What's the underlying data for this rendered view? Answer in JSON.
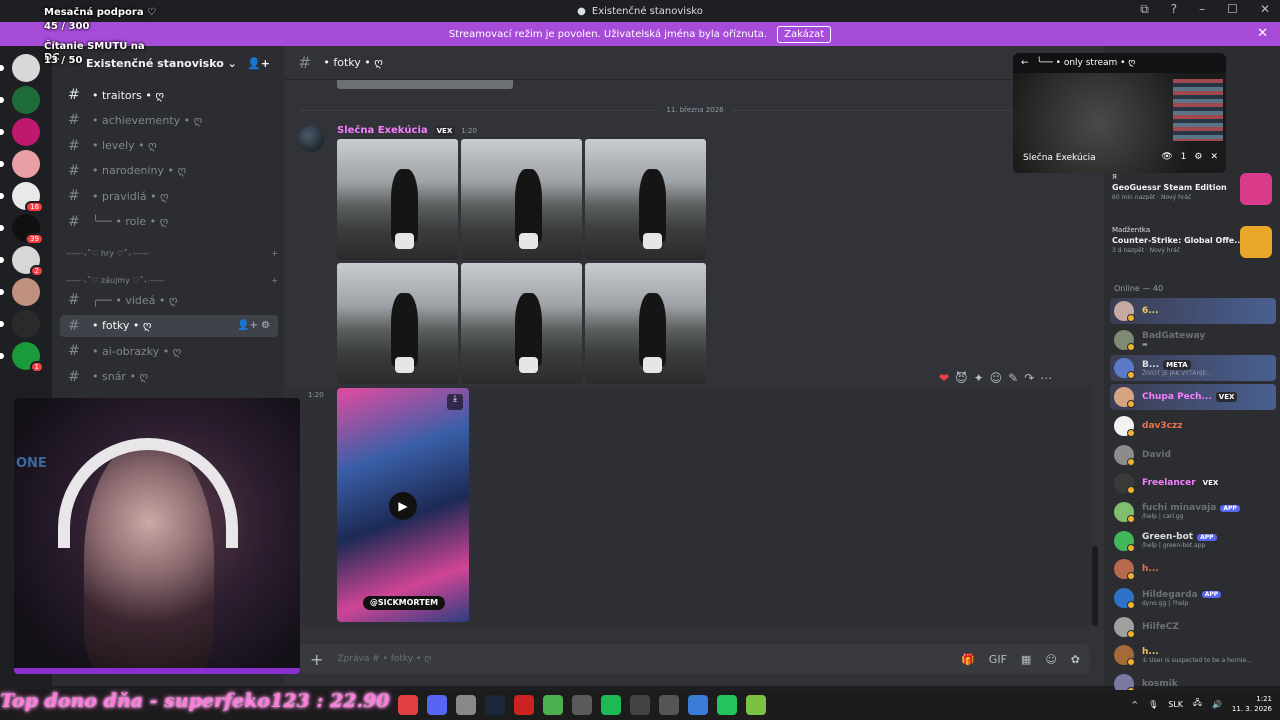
{
  "window": {
    "title": "Existenčné stanovisko",
    "controls": [
      "⧉",
      "?",
      "–",
      "☐",
      "✕"
    ]
  },
  "banner": {
    "text": "Streamovací režim je povolen. Uživatelská jména byla oříznuta.",
    "button": "Zakázat",
    "close": "✕"
  },
  "overlay": {
    "support_label": "Mesačná podpora ♡",
    "support_count": "45 / 300",
    "goal_label": "Čítanie SMUTU na DC",
    "goal_count": "13 / 50"
  },
  "servers": [
    {
      "color": "#d8d8d8",
      "badge": "",
      "pip": true
    },
    {
      "color": "#1e6b3a",
      "badge": "",
      "pip": true
    },
    {
      "color": "#c0186f",
      "badge": "",
      "pip": true
    },
    {
      "color": "#e9a0a4",
      "badge": "",
      "pip": true
    },
    {
      "color": "#e9e9e9",
      "badge": "16",
      "pip": true
    },
    {
      "color": "#101010",
      "badge": "39",
      "pip": true
    },
    {
      "color": "#d7d7d7",
      "badge": "2",
      "pip": true
    },
    {
      "color": "#c09080",
      "badge": "",
      "pip": true
    },
    {
      "color": "#2a2a2a",
      "badge": "",
      "pip": true
    },
    {
      "color": "#1a9a3a",
      "badge": "1",
      "pip": true
    }
  ],
  "guild": {
    "name": "Existenčné stanovisko",
    "chevron": "⌄",
    "invite_icon": "👤+"
  },
  "channels": [
    {
      "label": "• traitors • ღ",
      "state": "unread"
    },
    {
      "label": "• achievementy • ღ",
      "state": "muted"
    },
    {
      "label": "• levely • ღ",
      "state": "muted"
    },
    {
      "label": "• narodeniny • ღ",
      "state": "muted"
    },
    {
      "label": "• pravidlá • ღ",
      "state": "muted"
    },
    {
      "label": "╰── • role • ღ",
      "state": "muted"
    }
  ],
  "categories": [
    {
      "label": "-----‧₊˚♡ hry ♡˚₊‧-----",
      "caret": "›"
    },
    {
      "label": "-----‧₊˚♡ záujmy ♡˚₊‧-----",
      "caret": "⌄"
    }
  ],
  "channels2": [
    {
      "label": "╭── • videá • ღ",
      "state": "muted"
    },
    {
      "label": "• fotky • ღ",
      "state": "active"
    },
    {
      "label": "• ai-obrazky • ღ",
      "state": "muted"
    },
    {
      "label": "• snár • ღ",
      "state": "muted"
    }
  ],
  "topbar": {
    "channel": "• fotky • ღ"
  },
  "chat": {
    "date": "11. března 2026",
    "author": "Slečna Exekúcia",
    "tag": "VEX",
    "time": "1:20",
    "side_time": "1:20",
    "video_handle": "@SICKMORTEM",
    "hover_actions": [
      "❤",
      "😈",
      "✦",
      "☺",
      "✎",
      "↷",
      "⋯"
    ]
  },
  "composer": {
    "placeholder": "Zpráva #  • fotky • ღ",
    "plus": "+",
    "icons": [
      "🎁",
      "GIF",
      "▦",
      "☺",
      "✿"
    ]
  },
  "pip": {
    "title": "╰── • only stream • ღ",
    "streamer": "Slečna Exekúcia",
    "viewers": "1"
  },
  "activity": [
    {
      "who": "Я",
      "game": "GeoGuessr Steam Edition",
      "sub": "60 min nazpět · Nový hráč",
      "color": "#d93b8a"
    },
    {
      "who": "Madžentka",
      "game": "Counter-Strike: Global Offe...",
      "sub": "3 d nazpět · Nový hráč",
      "color": "#e8a72a"
    }
  ],
  "online": {
    "label": "Online — 40"
  },
  "members": [
    {
      "name": "6...",
      "status": "",
      "color": "#f0c75e",
      "app": "",
      "avatar": "#c7a9a3"
    },
    {
      "name": "BadGateway",
      "status": "▬",
      "color": "#6d6f78",
      "app": "",
      "avatar": "#7e8a73"
    },
    {
      "name": "B...",
      "status": "ŽIVOT JE JAK VÝTAHJE...",
      "color": "#dbdee1",
      "app": "META",
      "avatar": "#5c7ac6"
    },
    {
      "name": "Chupa Pech...",
      "status": "",
      "color": "#f47fff",
      "app": "VEX",
      "avatar": "#d6a383"
    },
    {
      "name": "dav3czz",
      "status": "",
      "color": "#e8744f",
      "app": "",
      "avatar": "#f2f2f2"
    },
    {
      "name": "David",
      "status": "",
      "color": "#6d6f78",
      "app": "",
      "avatar": "#8c8c8c"
    },
    {
      "name": "Freelancer",
      "status": "",
      "color": "#f47fff",
      "app": "VEX",
      "avatar": "#3a3a3a"
    },
    {
      "name": "fuchi minavaja",
      "status": "/help | carl.gg",
      "color": "#6d6f78",
      "app": "APP",
      "avatar": "#7fbf6f"
    },
    {
      "name": "Green-bot",
      "status": "/help | green-bot.app",
      "color": "#dbdee1",
      "app": "APP",
      "avatar": "#42b85a"
    },
    {
      "name": "h...",
      "status": "",
      "color": "#e8744f",
      "app": "",
      "avatar": "#b86a50"
    },
    {
      "name": "Hildegarda",
      "status": "dyno.gg | ?help",
      "color": "#6d6f78",
      "app": "APP",
      "avatar": "#2f73c9"
    },
    {
      "name": "HilfeCZ",
      "status": "",
      "color": "#6d6f78",
      "app": "",
      "avatar": "#a0a0a0"
    },
    {
      "name": "h...",
      "status": "① User is suspected to be a hornie...",
      "color": "#f0c75e",
      "app": "",
      "avatar": "#a56a3a"
    },
    {
      "name": "kosmik",
      "status": "",
      "color": "#6d6f78",
      "app": "",
      "avatar": "#7a7aa0"
    }
  ],
  "webcam": {
    "logo": "ONE"
  },
  "donation": {
    "text": "Top dono dňa - superfeko123 : 22.90"
  },
  "taskbar": {
    "icons": [
      "#e04040",
      "#5865f2",
      "#888888",
      "#1b2838",
      "#cc2222",
      "#4caf50",
      "#5a5a5a",
      "#1db954",
      "#444444",
      "#555555",
      "#3a7bd5",
      "#23c45e",
      "#7cc242"
    ],
    "lang": "SLK",
    "time": "1:21",
    "date": "11. 3. 2026"
  }
}
